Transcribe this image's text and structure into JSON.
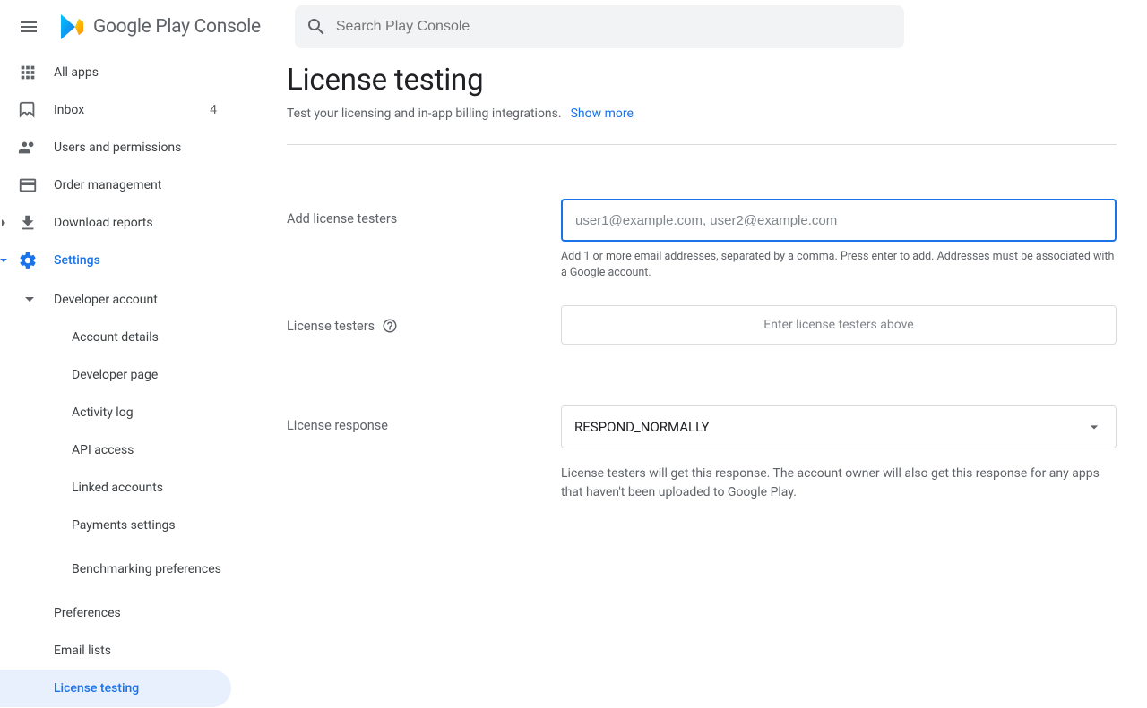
{
  "app": {
    "logo_text": "Google Play Console",
    "search_placeholder": "Search Play Console"
  },
  "sidebar": {
    "all_apps": "All apps",
    "inbox": {
      "label": "Inbox",
      "badge": "4"
    },
    "users_permissions": "Users and permissions",
    "order_management": "Order management",
    "download_reports": "Download reports",
    "settings": "Settings",
    "developer_account": "Developer account",
    "account_details": "Account details",
    "developer_page": "Developer page",
    "activity_log": "Activity log",
    "api_access": "API access",
    "linked_accounts": "Linked accounts",
    "payments_settings": "Payments settings",
    "benchmarking_preferences": "Benchmarking preferences",
    "preferences": "Preferences",
    "email_lists": "Email lists",
    "license_testing": "License testing"
  },
  "main": {
    "title": "License testing",
    "subtitle": "Test your licensing and in-app billing integrations.",
    "show_more": "Show more",
    "add_testers_label": "Add license testers",
    "add_testers_placeholder": "user1@example.com, user2@example.com",
    "add_testers_hint": "Add 1 or more email addresses, separated by a comma. Press enter to add. Addresses must be associated with a Google account.",
    "license_testers_label": "License testers",
    "license_testers_empty": "Enter license testers above",
    "license_response_label": "License response",
    "license_response_value": "RESPOND_NORMALLY",
    "license_response_desc": "License testers will get this response. The account owner will also get this response for any apps that haven't been uploaded to Google Play."
  }
}
